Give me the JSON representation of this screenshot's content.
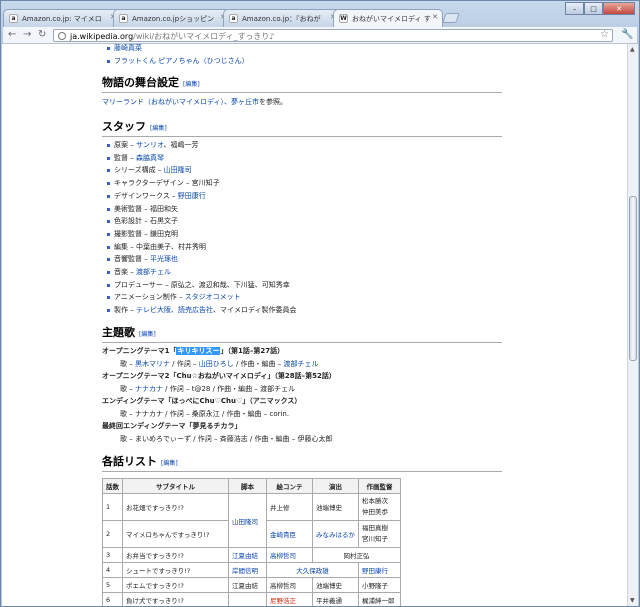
{
  "browser": {
    "tabs": [
      {
        "icon": "a",
        "label": "Amazon.co.jp: マイメロ"
      },
      {
        "icon": "a",
        "label": "Amazon.co.jpショッピン"
      },
      {
        "icon": "a",
        "label": "Amazon.co.jp：『おねが"
      },
      {
        "icon": "W",
        "label": "おねがいマイメロディ す"
      }
    ],
    "url_host": "ja.wikipedia.org",
    "url_path": "/wiki/おねがいマイメロディ_すっきり♪"
  },
  "article": {
    "top_items": [
      "藤崎真菜",
      "フラットくん ピアノちゃん（ひつじさん）"
    ],
    "setting": {
      "heading": "物語の舞台設定",
      "edit": "[編集]",
      "text_link": "マリーランド（おねがいマイメロディ）、夢ヶ丘市",
      "text_suffix": "を参照。"
    },
    "staff": {
      "heading": "スタッフ",
      "edit": "[編集]",
      "items": [
        {
          "role": "原案 – ",
          "link": "サンリオ",
          "rest": "、福嶋一芳"
        },
        {
          "role": "監督 – ",
          "link": "森脇真琴",
          "rest": ""
        },
        {
          "role": "シリーズ構成 – ",
          "link": "山田隆司",
          "rest": ""
        },
        {
          "role": "キャラクターデザイン – 宮川知子",
          "link": "",
          "rest": ""
        },
        {
          "role": "デザインワークス – ",
          "link": "野田康行",
          "rest": ""
        },
        {
          "role": "美術監督 – 福田和矢",
          "link": "",
          "rest": ""
        },
        {
          "role": "色彩設計 – 石黒文子",
          "link": "",
          "rest": ""
        },
        {
          "role": "撮影監督 – 鎌田克明",
          "link": "",
          "rest": ""
        },
        {
          "role": "編集 – 中葉由美子、村井秀明",
          "link": "",
          "rest": ""
        },
        {
          "role": "音響監督 – ",
          "link": "平光琢也",
          "rest": ""
        },
        {
          "role": "音楽 – ",
          "link": "渡部チェル",
          "rest": ""
        },
        {
          "role": "プロデューサー – 原弘之、渡辺和哉、下川猛、可知秀幸",
          "link": "",
          "rest": ""
        },
        {
          "role": "アニメーション制作 – ",
          "link": "スタジオコメット",
          "rest": ""
        },
        {
          "role": "製作 – ",
          "link": "テレビ大阪、読売広告社",
          "rest": "、マイメロディ製作委員会"
        }
      ]
    },
    "theme": {
      "heading": "主題歌",
      "edit": "[編集]",
      "op1_pre": "オープニングテーマ1「",
      "op1_song": "キリキリスー",
      "op1_post": "」（第1話–第27話）",
      "op1_credit_pre": "歌 – ",
      "op1_credit_singer": "黒木マリナ",
      "op1_credit_mid": " / 作詞 – ",
      "op1_credit_lyr": "山田ひろし",
      "op1_credit_mid2": " / 作曲・編曲 – ",
      "op1_credit_comp": "渡部チェル",
      "op2_title": "オープニングテーマ2「Chu☆おねがいマイメロディ」（第28話–第52話）",
      "op2_credit_pre": "歌 – ",
      "op2_credit_link": "ナナカナ",
      "op2_credit_rest": " / 作詞 – t@28 / 作曲・編曲 – 渡部チェル",
      "ed_title": "エンディングテーマ「ほっぺにChu♡Chu♡」（アニマックス）",
      "ed_credit": "歌 – ナナカナ / 作詞 – 桑原永江 / 作曲・編曲 – corin.",
      "final_title": "最終回エンディングテーマ「夢見るチカラ」",
      "final_credit": "歌 – まいめろでぃーず / 作詞 – 斉藤浩志 / 作曲・編曲 – 伊藤心太郎"
    },
    "episodes": {
      "heading": "各話リスト",
      "edit": "[編集]",
      "columns": [
        "話数",
        "サブタイトル",
        "脚本",
        "絵コンテ",
        "演出",
        "作画監督"
      ],
      "rows": [
        {
          "no": "1",
          "title": "お花畑ですっきり!?",
          "script": "山田隆司",
          "board": "井上修",
          "dir": "池端博史",
          "anim": "松本勝次\n仲田美歩"
        },
        {
          "no": "2",
          "title": "マイメロちゃんですっきり!?",
          "script": "",
          "board": "金崎貴臣",
          "dir": "みなみはるか",
          "anim": "福田真樹\n宮川知子"
        },
        {
          "no": "3",
          "title": "お弁当ですっきり!?",
          "script": "江夏由結",
          "board": "高柳哲司",
          "dir": "岡村正弘",
          "anim": ""
        },
        {
          "no": "4",
          "title": "シュートですっきり!?",
          "script": "岸間信明",
          "board": "大久保政雄",
          "dir": "",
          "anim": "野田康行"
        },
        {
          "no": "5",
          "title": "ポエムですっきり!?",
          "script": "江夏由結",
          "board": "高柳哲司",
          "dir": "池端博史",
          "anim": "小野隆子"
        },
        {
          "no": "6",
          "title": "負け犬ですっきり!?",
          "script": "",
          "board": "尼野浩正",
          "dir": "平井義通",
          "anim": "梶浦紳一郎"
        }
      ]
    }
  },
  "colors": {
    "link": "#0645ad",
    "selection": "#3399ff",
    "redlink": "#cc2200"
  }
}
